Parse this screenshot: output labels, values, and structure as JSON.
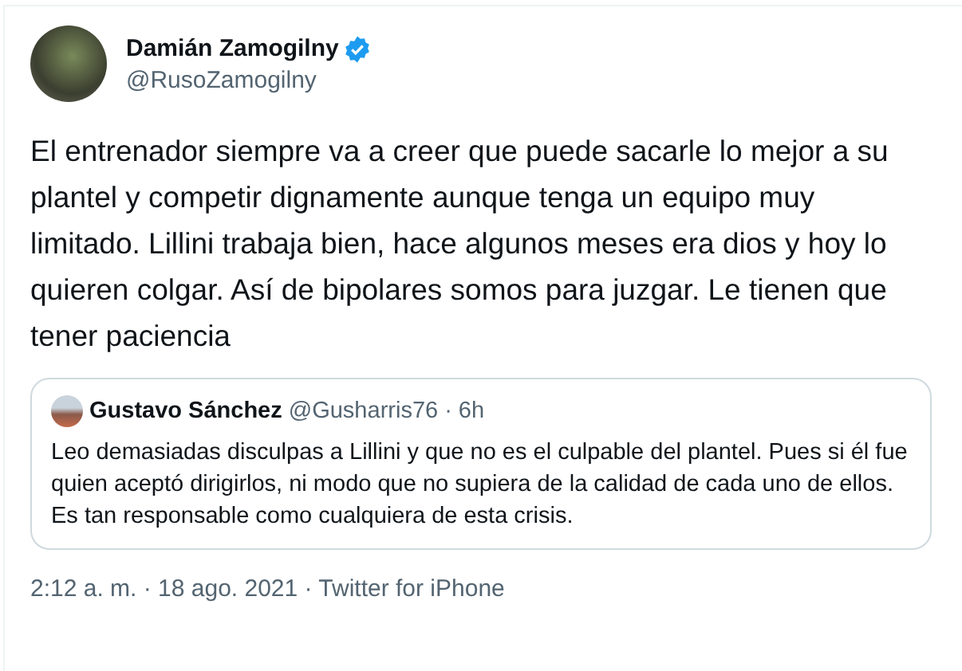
{
  "author": {
    "name": "Damián Zamogilny",
    "handle": "@RusoZamogilny",
    "verified": true
  },
  "text": "El entrenador siempre va a creer que puede sacarle lo mejor a su plantel y competir dignamente aunque tenga un equipo muy limitado. Lillini trabaja bien, hace algunos meses era dios y hoy lo quieren colgar. Así de bipolares somos para juzgar. Le tienen que tener paciencia",
  "quoted": {
    "name": "Gustavo Sánchez",
    "handle": "@Gusharris76",
    "time": "· 6h",
    "text": "Leo demasiadas disculpas a Lillini y que no es el culpable del plantel. Pues si él fue quien aceptó dirigirlos, ni modo que no supiera de la calidad de cada uno de ellos. Es tan responsable como cualquiera de esta crisis."
  },
  "footer": "2:12 a. m. · 18 ago. 2021 · Twitter for iPhone"
}
